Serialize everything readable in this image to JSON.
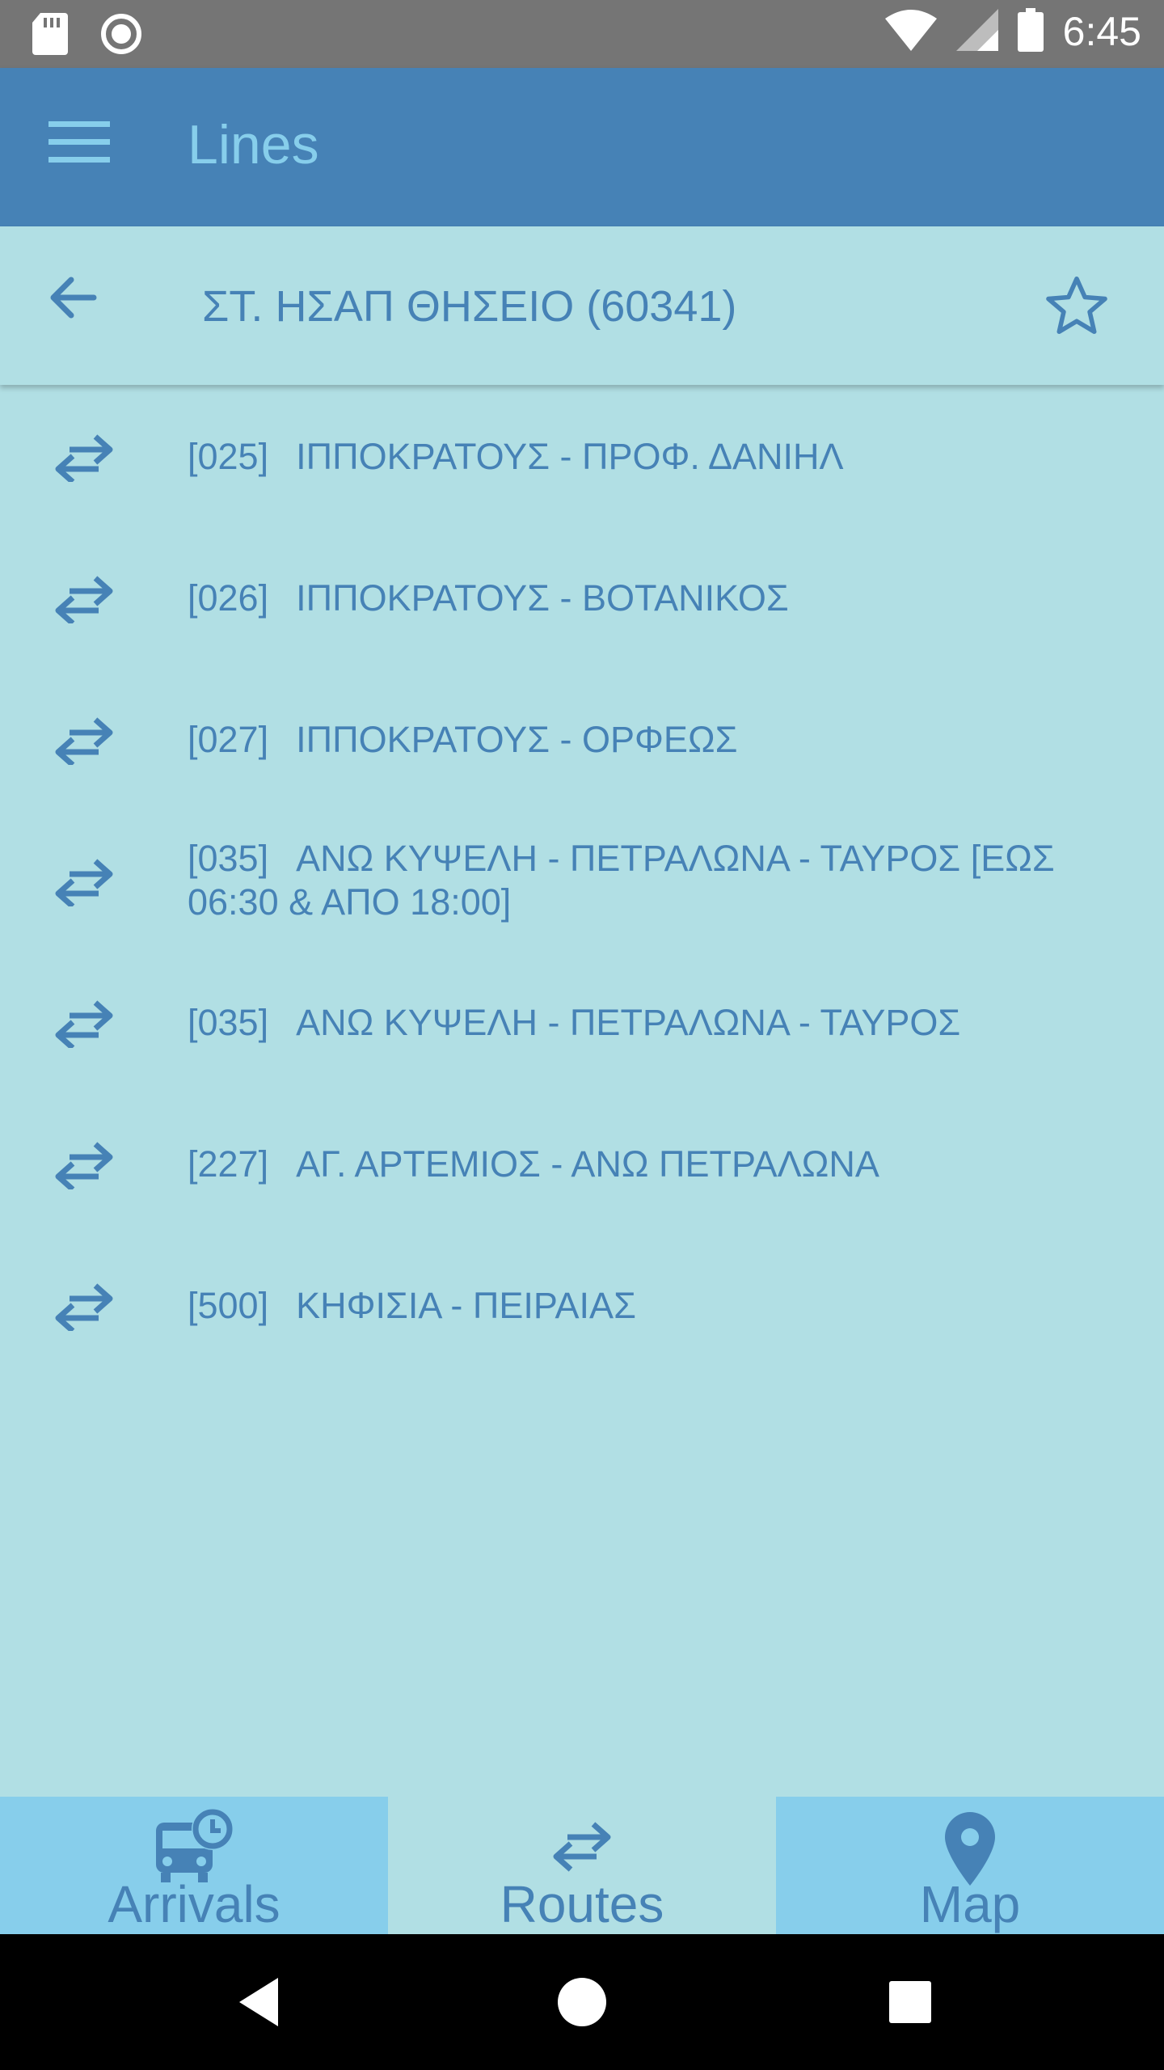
{
  "status_bar": {
    "time": "6:45",
    "icons": [
      "sd-card-icon",
      "sync-icon",
      "wifi-icon",
      "signal-icon",
      "battery-icon"
    ]
  },
  "app_bar": {
    "title": "Lines",
    "menu_icon": "menu-icon"
  },
  "stop": {
    "name": "ΣΤ. ΗΣΑΠ ΘΗΣΕΙΟ (60341)",
    "back_icon": "arrow-left-icon",
    "favorite_icon": "star-outline-icon"
  },
  "routes": [
    {
      "code": "[025]",
      "name": "ΙΠΠΟΚΡΑΤΟΥΣ - ΠΡΟΦ. ΔΑΝΙΗΛ",
      "icon": "swap-horizontal-icon"
    },
    {
      "code": "[026]",
      "name": "ΙΠΠΟΚΡΑΤΟΥΣ - ΒΟΤΑΝΙΚΟΣ",
      "icon": "swap-horizontal-icon"
    },
    {
      "code": "[027]",
      "name": "ΙΠΠΟΚΡΑΤΟΥΣ - ΟΡΦΕΩΣ",
      "icon": "swap-horizontal-icon"
    },
    {
      "code": "[035]",
      "name": "ΑΝΩ ΚΥΨΕΛΗ - ΠΕΤΡΑΛΩΝΑ - ΤΑΥΡΟΣ [ΕΩΣ",
      "name_line2": "06:30 & ΑΠΟ 18:00]",
      "icon": "swap-horizontal-icon"
    },
    {
      "code": "[035]",
      "name": "ΑΝΩ ΚΥΨΕΛΗ - ΠΕΤΡΑΛΩΝΑ - ΤΑΥΡΟΣ",
      "icon": "swap-horizontal-icon"
    },
    {
      "code": "[227]",
      "name": "ΑΓ. ΑΡΤΕΜΙΟΣ - ΑΝΩ ΠΕΤΡΑΛΩΝΑ",
      "icon": "swap-horizontal-icon"
    },
    {
      "code": "[500]",
      "name": "ΚΗΦΙΣΙΑ - ΠΕΙΡΑΙΑΣ",
      "icon": "swap-horizontal-icon"
    }
  ],
  "bottom_nav": {
    "tabs": [
      {
        "label": "Arrivals",
        "icon": "bus-clock-icon",
        "active": false
      },
      {
        "label": "Routes",
        "icon": "swap-horizontal-icon",
        "active": true
      },
      {
        "label": "Map",
        "icon": "map-marker-icon",
        "active": false
      }
    ]
  },
  "nav_bar": {
    "buttons": [
      "back-triangle-icon",
      "home-circle-icon",
      "recents-square-icon"
    ]
  },
  "colors": {
    "app_bar": "#4682b6",
    "background": "#b1dfe4",
    "accent_text": "#4682b6",
    "title_text": "#87ceeb",
    "tab_inactive": "#87ceeb",
    "status_bar": "#757575"
  }
}
